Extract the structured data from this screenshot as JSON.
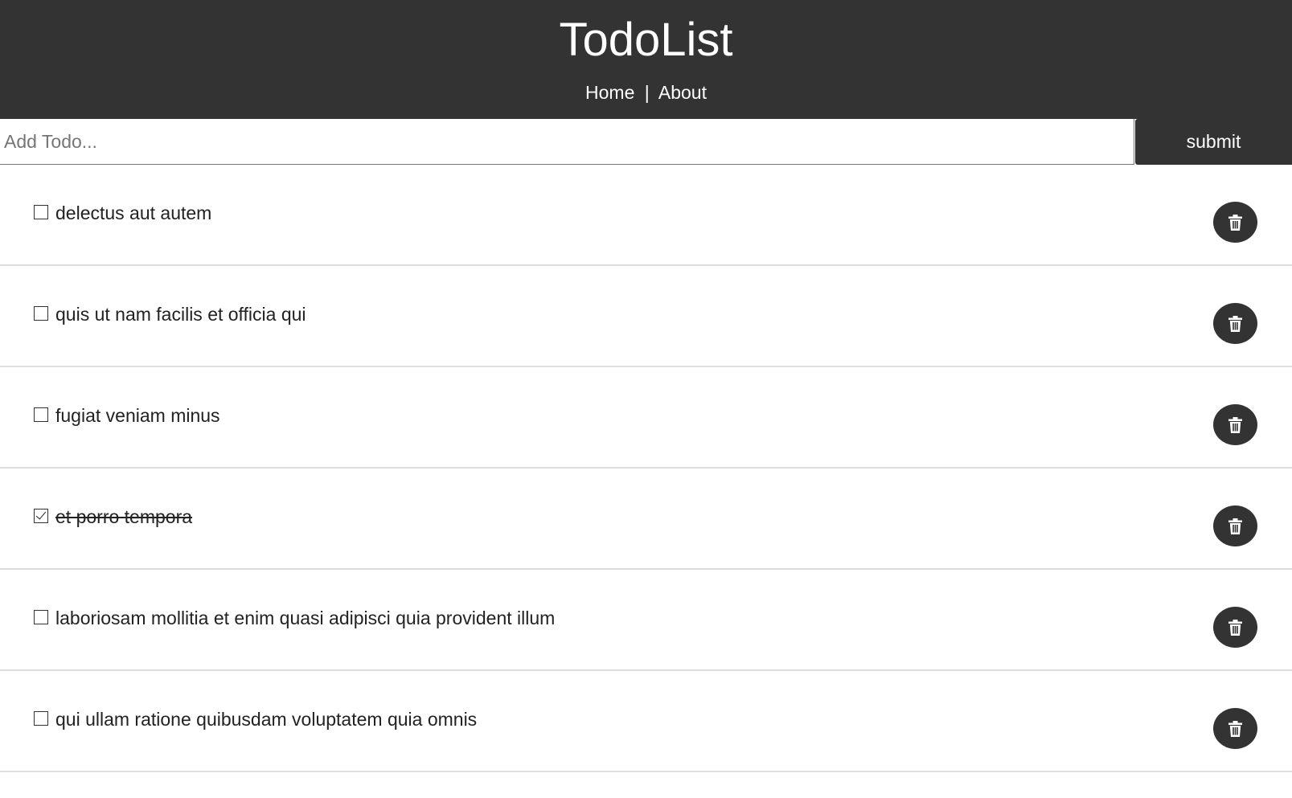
{
  "header": {
    "title": "TodoList",
    "nav": [
      {
        "label": "Home"
      },
      {
        "label": "About"
      }
    ],
    "separator": "|"
  },
  "add_form": {
    "placeholder": "Add Todo...",
    "value": "",
    "submit_label": "submit"
  },
  "todos": [
    {
      "title": "delectus aut autem",
      "completed": false
    },
    {
      "title": "quis ut nam facilis et officia qui",
      "completed": false
    },
    {
      "title": "fugiat veniam minus",
      "completed": false
    },
    {
      "title": "et porro tempora",
      "completed": true
    },
    {
      "title": "laboriosam mollitia et enim quasi adipisci quia provident illum",
      "completed": false
    },
    {
      "title": "qui ullam ratione quibusdam voluptatem quia omnis",
      "completed": false
    }
  ],
  "icons": {
    "delete": "trash-icon"
  },
  "colors": {
    "header_bg": "#333333",
    "button_bg": "#333333",
    "text": "#222222",
    "divider": "#dddddd"
  }
}
